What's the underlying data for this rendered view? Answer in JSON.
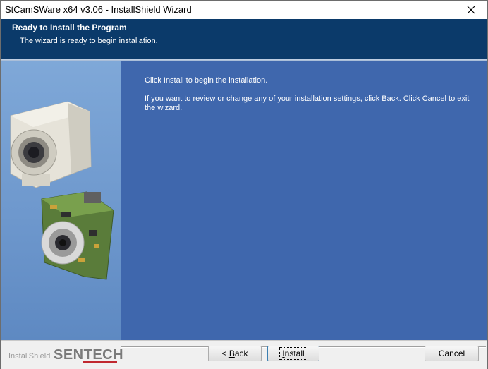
{
  "window": {
    "title": "StCamSWare x64 v3.06 - InstallShield Wizard"
  },
  "header": {
    "title": "Ready to Install the Program",
    "subtitle": "The wizard is ready to begin installation."
  },
  "main": {
    "paragraph1": "Click Install to begin the installation.",
    "paragraph2": "If you want to review or change any of your installation settings, click Back. Click Cancel to exit the wizard."
  },
  "footer": {
    "installshield_label": "InstallShield",
    "brand_prefix": "SEN",
    "brand_suffix": "TECH"
  },
  "buttons": {
    "back_prefix": "< ",
    "back_accel": "B",
    "back_rest": "ack",
    "install_accel": "I",
    "install_rest": "nstall",
    "cancel": "Cancel"
  },
  "colors": {
    "header_bg": "#0b3a6a",
    "content_bg": "#3f67ad",
    "brand_red": "#c0282f"
  },
  "icons": {
    "close": "close-icon",
    "camera_housing": "camera-housing-image",
    "camera_board": "camera-board-image"
  }
}
